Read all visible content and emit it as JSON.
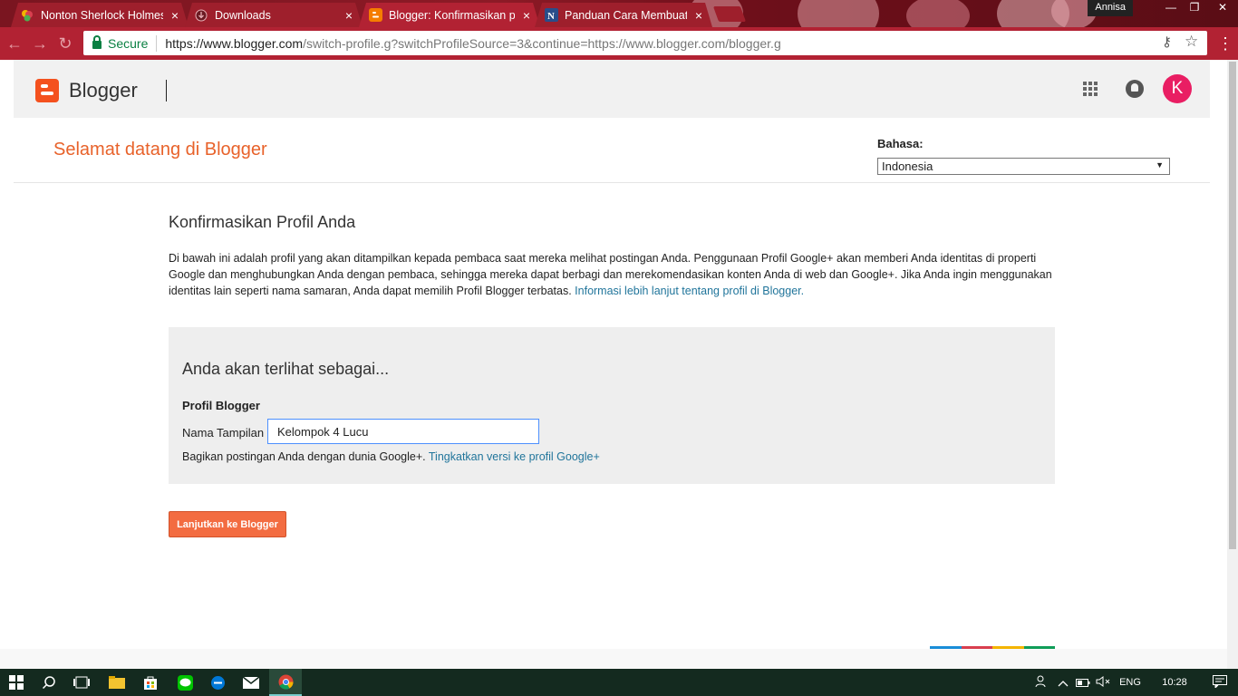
{
  "browser": {
    "tabs": [
      {
        "title": "Nonton Sherlock Holmes",
        "favicon": "colorful-logo-icon",
        "active": false
      },
      {
        "title": "Downloads",
        "favicon": "download-icon",
        "active": false
      },
      {
        "title": "Blogger: Konfirmasikan p",
        "favicon": "blogger-icon",
        "active": true
      },
      {
        "title": "Panduan Cara Membuat",
        "favicon": "n-letter-icon",
        "active": false
      }
    ],
    "tab_close": "×",
    "window_user": "Annisa",
    "window_controls": {
      "minimize": "—",
      "maximize": "❐",
      "close": "✕"
    },
    "toolbar": {
      "back": "←",
      "forward": "→",
      "reload": "↻",
      "secure_label": "Secure",
      "url_host": "https://www.blogger.com",
      "url_path": "/switch-profile.g?switchProfileSource=3&continue=https://www.blogger.com/blogger.g",
      "key_icon": "⚷",
      "star_icon": "☆",
      "menu_icon": "⋮"
    }
  },
  "header": {
    "brand": "Blogger",
    "avatar_letter": "K",
    "avatar_color": "#e91e63"
  },
  "welcome": {
    "title": "Selamat datang di Blogger",
    "language_label": "Bahasa:",
    "language_value": "Indonesia",
    "select_arrow": "▼"
  },
  "confirm": {
    "title": "Konfirmasikan Profil Anda",
    "description": "Di bawah ini adalah profil yang akan ditampilkan kepada pembaca saat mereka melihat postingan Anda. Penggunaan Profil Google+ akan memberi Anda identitas di properti Google dan menghubungkan Anda dengan pembaca, sehingga mereka dapat berbagi dan merekomendasikan konten Anda di web dan Google+. Jika Anda ingin menggunakan identitas lain seperti nama samaran, Anda dapat memilih Profil Blogger terbatas.",
    "info_link": "Informasi lebih lanjut tentang profil di Blogger."
  },
  "profile": {
    "appear_as": "Anda akan terlihat sebagai...",
    "type": "Profil Blogger",
    "name_label": "Nama Tampilan",
    "name_value": "Kelompok 4 Lucu",
    "share_text": "Bagikan postingan Anda dengan dunia Google+.",
    "upgrade_link": "Tingkatkan versi ke profil Google+"
  },
  "actions": {
    "continue_label": "Lanjutkan ke Blogger"
  },
  "colors": {
    "accent": "#f36c41",
    "welcome": "#e8622a",
    "link": "#21759b",
    "chrome": "#b22233",
    "google_bar": [
      "#1a73e8",
      "#d93f4f",
      "#f4b400",
      "#0f9d58"
    ]
  },
  "taskbar": {
    "language": "ENG",
    "time": "10:28"
  }
}
